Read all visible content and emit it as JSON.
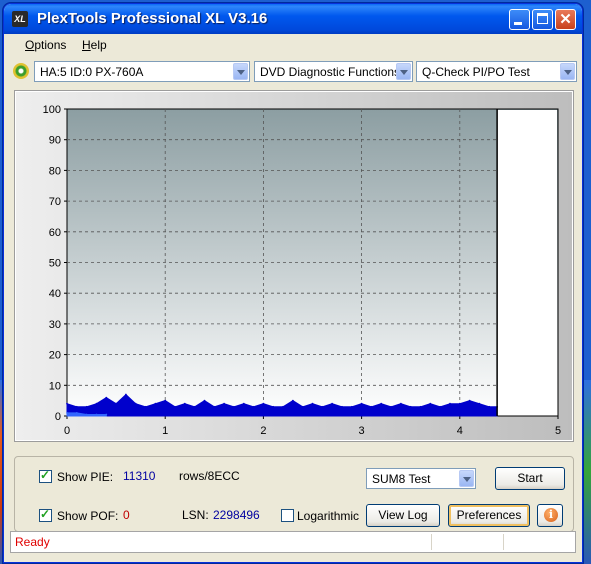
{
  "window": {
    "title": "PlexTools Professional XL V3.16",
    "icon_text": "XL",
    "controls": [
      "minimize",
      "maximize",
      "close"
    ]
  },
  "menu": {
    "items": [
      {
        "label": "Options",
        "accel": "O",
        "rest": "ptions"
      },
      {
        "label": "Help",
        "accel": "H",
        "rest": "elp"
      }
    ]
  },
  "toolbar": {
    "drive": "HA:5 ID:0  PX-760A",
    "function": "DVD Diagnostic Functions",
    "test": "Q-Check PI/PO Test"
  },
  "chart_data": {
    "type": "area",
    "title": "",
    "xlabel": "",
    "ylabel": "",
    "xlim": [
      0,
      5
    ],
    "ylim": [
      0,
      100
    ],
    "x_ticks": [
      "0",
      "1",
      "2",
      "3",
      "4",
      "5"
    ],
    "y_ticks": [
      "0",
      "10",
      "20",
      "30",
      "40",
      "50",
      "60",
      "70",
      "80",
      "90",
      "100"
    ],
    "grid": true,
    "end_marker_x": 4.38,
    "series": [
      {
        "color": "#0000cc",
        "x": [
          0.0,
          0.1,
          0.2,
          0.3,
          0.4,
          0.5,
          0.6,
          0.7,
          0.8,
          0.9,
          1.0,
          1.1,
          1.2,
          1.3,
          1.4,
          1.5,
          1.6,
          1.7,
          1.8,
          1.9,
          2.0,
          2.1,
          2.2,
          2.3,
          2.4,
          2.5,
          2.6,
          2.7,
          2.8,
          2.9,
          3.0,
          3.1,
          3.2,
          3.3,
          3.4,
          3.5,
          3.6,
          3.7,
          3.8,
          3.9,
          4.0,
          4.1,
          4.2,
          4.3,
          4.38
        ],
        "values": [
          4,
          3,
          3,
          4,
          6,
          4,
          7,
          4,
          3,
          4,
          5,
          3,
          4,
          3,
          5,
          3,
          4,
          3,
          4,
          3,
          4,
          3,
          3,
          5,
          3,
          4,
          3,
          4,
          3,
          3,
          4,
          3,
          4,
          3,
          4,
          3,
          3,
          4,
          3,
          4,
          4,
          5,
          4,
          3,
          3
        ]
      },
      {
        "color": "#3366ff",
        "x": [
          0.0,
          0.1,
          0.2,
          0.3,
          0.4
        ],
        "values": [
          1,
          1,
          0.5,
          0.5,
          0.5
        ]
      }
    ]
  },
  "options": {
    "show_pie_label": "Show PIE:",
    "pie_value": "11310",
    "rows_label": "rows/8ECC",
    "show_pof_label": "Show POF:",
    "pof_value": "0",
    "lsn_label": "LSN:",
    "lsn_value": "2298496",
    "log_label": "Logarithmic",
    "test_select": "SUM8 Test",
    "start": "Start",
    "view_log": "View Log",
    "preferences": "Preferences",
    "show_pie_checked": true,
    "show_pof_checked": true,
    "log_checked": false
  },
  "status": {
    "text": "Ready"
  }
}
